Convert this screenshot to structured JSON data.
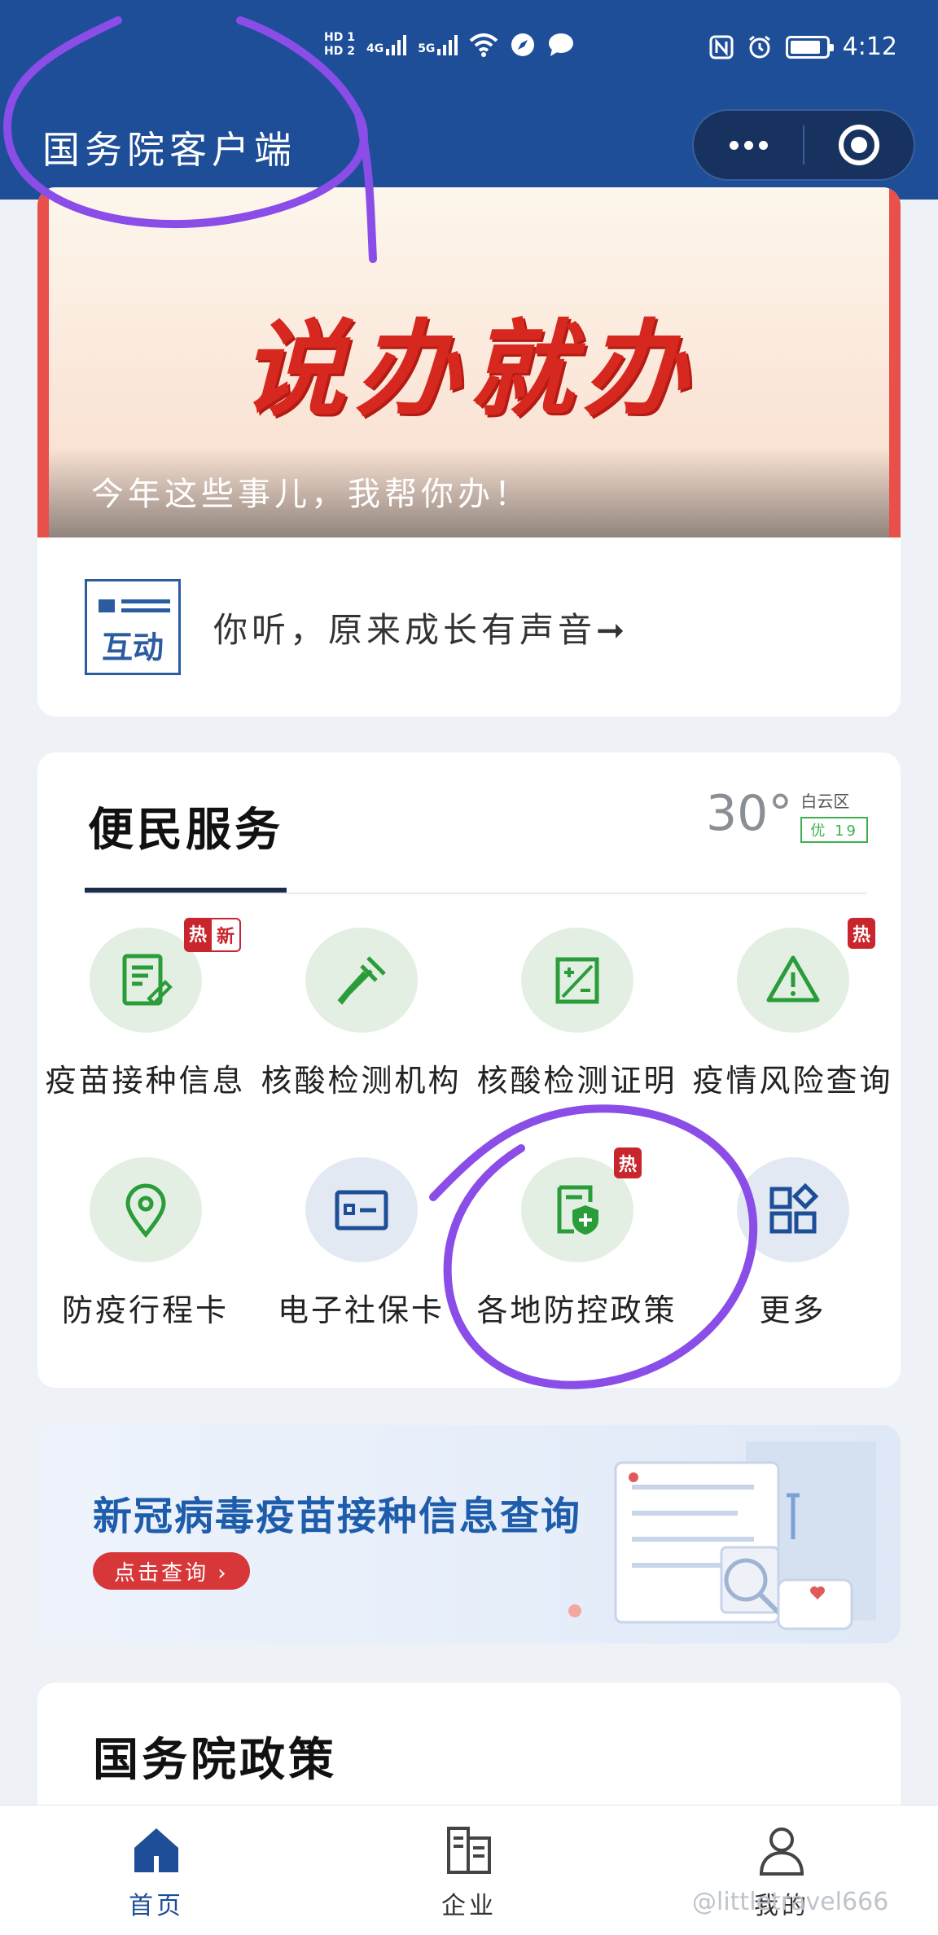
{
  "status_bar": {
    "hd1": "HD 1",
    "hd2": "HD 2",
    "net1": "4G",
    "net2": "5G",
    "time": "4:12"
  },
  "header": {
    "title": "国务院客户端"
  },
  "banner": {
    "headline": "说办就办",
    "caption": "今年这些事儿，我帮你办！"
  },
  "interaction": {
    "icon_text": "互动",
    "text": "你听，原来成长有声音➞"
  },
  "services": {
    "title": "便民服务",
    "weather": {
      "temp": "30°",
      "district": "白云区",
      "aqi": "优 19"
    },
    "items": [
      {
        "label": "疫苗接种信息",
        "badges": [
          "热",
          "新"
        ]
      },
      {
        "label": "核酸检测机构",
        "badges": []
      },
      {
        "label": "核酸检测证明",
        "badges": []
      },
      {
        "label": "疫情风险查询",
        "badges": [
          "热"
        ]
      },
      {
        "label": "防疫行程卡",
        "badges": []
      },
      {
        "label": "电子社保卡",
        "badges": []
      },
      {
        "label": "各地防控政策",
        "badges": [
          "热"
        ]
      },
      {
        "label": "更多",
        "badges": []
      }
    ]
  },
  "promo": {
    "title": "新冠病毒疫苗接种信息查询",
    "button": "点击查询 ›"
  },
  "policy": {
    "title": "国务院政策"
  },
  "tabbar": {
    "tabs": [
      {
        "label": "首页"
      },
      {
        "label": "企业"
      },
      {
        "label": "我的"
      }
    ]
  },
  "watermark": "@littletravel666",
  "colors": {
    "header_bg": "#1d4e97",
    "accent_red": "#c8252c",
    "icon_green": "#2a9d3a",
    "annotation_purple": "#8a4de8"
  }
}
